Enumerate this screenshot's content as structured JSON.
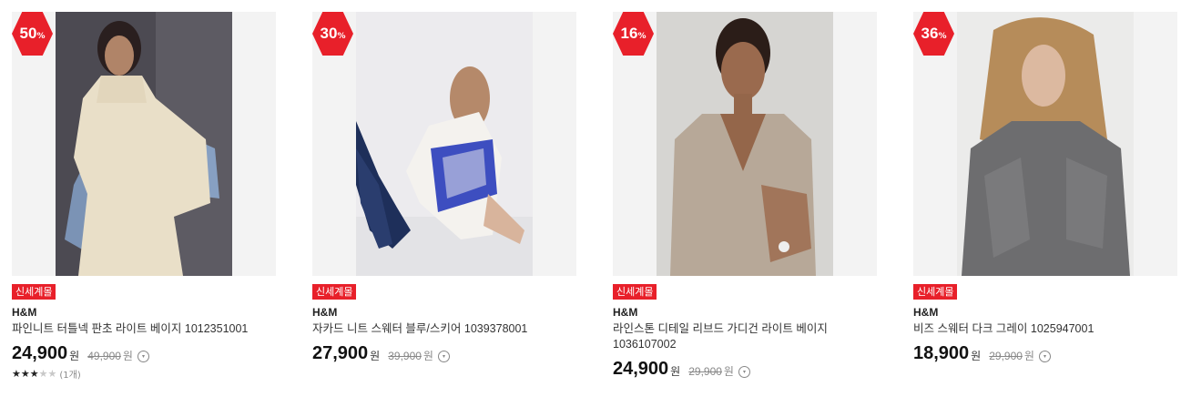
{
  "products": [
    {
      "discount": "50",
      "pct": "%",
      "tag": "신세계몰",
      "brand": "H&M",
      "name": "파인니트 터틀넥 판초 라이트 베이지 1012351001",
      "price": "24,900",
      "won": "원",
      "original": "49,900",
      "original_won": "원",
      "rating_stars": 3,
      "rating_count": "(1개)",
      "image": "woman-beige-poncho-photo"
    },
    {
      "discount": "30",
      "pct": "%",
      "tag": "신세계몰",
      "brand": "H&M",
      "name": "자카드 니트 스웨터 블루/스키어 1039378001",
      "price": "27,900",
      "won": "원",
      "original": "39,900",
      "original_won": "원",
      "image": "woman-jacquard-sweater-photo"
    },
    {
      "discount": "16",
      "pct": "%",
      "tag": "신세계몰",
      "brand": "H&M",
      "name": "라인스톤 디테일 리브드 가디건 라이트 베이지 1036107002",
      "price": "24,900",
      "won": "원",
      "original": "29,900",
      "original_won": "원",
      "image": "woman-ribbed-cardigan-photo"
    },
    {
      "discount": "36",
      "pct": "%",
      "tag": "신세계몰",
      "brand": "H&M",
      "name": "비즈 스웨터 다크 그레이 1025947001",
      "price": "18,900",
      "won": "원",
      "original": "29,900",
      "original_won": "원",
      "image": "woman-grey-beaded-sweater-photo"
    }
  ],
  "colors": {
    "badge": "#e8202a",
    "tag": "#e8202a"
  },
  "icons": {
    "info": "info-circle-icon",
    "star": "star-icon"
  }
}
